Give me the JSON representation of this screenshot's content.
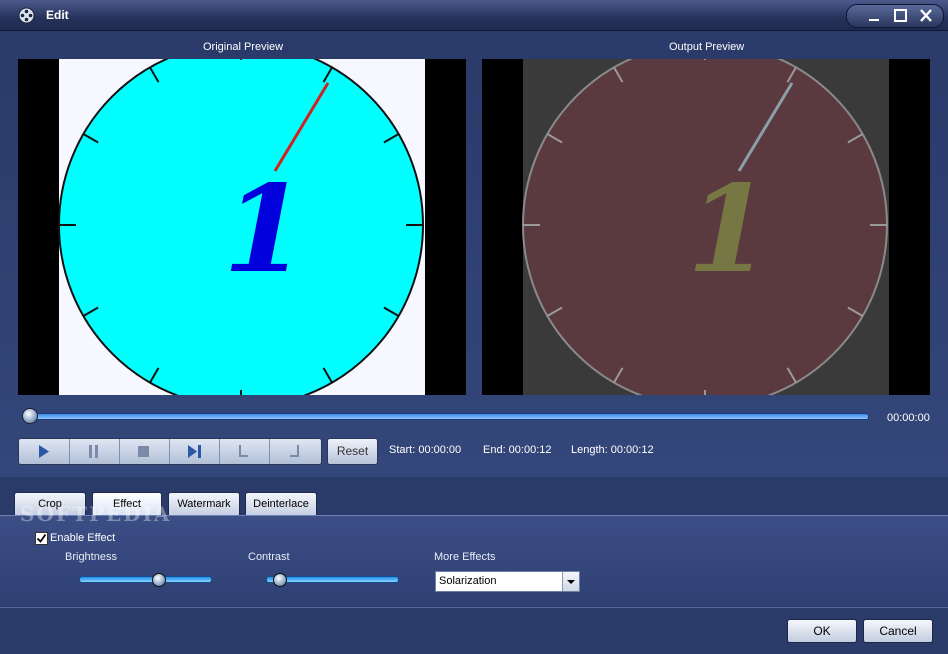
{
  "window": {
    "title": "Edit",
    "controls": [
      "minimize-icon",
      "maximize-icon",
      "close-icon"
    ]
  },
  "preview": {
    "original_label": "Original Preview",
    "output_label": "Output Preview",
    "clock_number": "1"
  },
  "seek": {
    "time": "00:00:00",
    "position": 0
  },
  "playback": {
    "buttons": [
      "play-icon",
      "pause-icon",
      "stop-icon",
      "next-frame-icon",
      "mark-start-icon",
      "mark-end-icon"
    ],
    "reset_label": "Reset",
    "start": "Start: 00:00:00",
    "end": "End: 00:00:12",
    "length": "Length: 00:00:12"
  },
  "tabs": [
    {
      "label": "Crop",
      "active": false
    },
    {
      "label": "Effect",
      "active": true
    },
    {
      "label": "Watermark",
      "active": false
    },
    {
      "label": "Deinterlace",
      "active": false
    }
  ],
  "effect": {
    "enable_label": "Enable Effect",
    "enabled": true,
    "brightness_label": "Brightness",
    "brightness_value": 0.6,
    "contrast_label": "Contrast",
    "contrast_value": 0.1,
    "more_effects_label": "More Effects",
    "more_effects_value": "Solarization"
  },
  "watermark_text": "SOFTPEDIA",
  "footer": {
    "ok_label": "OK",
    "cancel_label": "Cancel"
  },
  "colors": {
    "clock_face_original": "#00ffff",
    "clock_hand_original": "#d62020",
    "clock_numeral_original": "#0000dd",
    "clock_face_output": "#5a3a3e",
    "clock_numeral_output": "#777744",
    "slider_accent": "#2f97f0"
  }
}
